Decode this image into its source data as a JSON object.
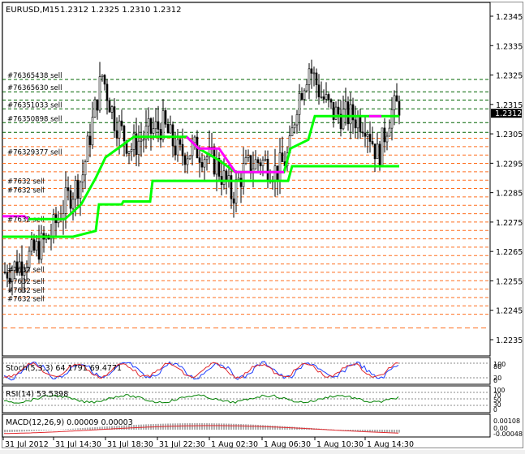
{
  "header": {
    "symbol": "EURUSD,M15",
    "ohlc": "1.2312 1.2325 1.2310 1.2312",
    "down_arrow": "▼"
  },
  "main": {
    "price_axis": [
      "1.2345",
      "1.2335",
      "1.2325",
      "1.2315",
      "1.2305",
      "1.2295",
      "1.2285",
      "1.2275",
      "1.2265",
      "1.2255",
      "1.2245",
      "1.2235"
    ],
    "current_price": "1.2312",
    "order_labels": [
      {
        "text": "#76365438 sell",
        "price": 1.23235
      },
      {
        "text": "#76365630 sell",
        "price": 1.23193
      },
      {
        "text": "#76351033 sell",
        "price": 1.23135
      },
      {
        "text": "#76350898 sell",
        "price": 1.23088
      },
      {
        "text": "#76329377 sell",
        "price": 1.22975
      },
      {
        "text": "#7632 sell",
        "price": 1.22875
      },
      {
        "text": "#7632 sell",
        "price": 1.22845
      },
      {
        "text": "#7632 sell",
        "price": 1.22745
      },
      {
        "text": "#7632 sell",
        "price": 1.22575
      },
      {
        "text": "#7632 sell",
        "price": 1.22535
      },
      {
        "text": "#7632 sell",
        "price": 1.22505
      },
      {
        "text": "#7632 sell",
        "price": 1.22475
      }
    ]
  },
  "stoch": {
    "label": "Stoch(5,3,3) 64.1791 69.4771",
    "axis": [
      "100",
      "80",
      "20",
      "0"
    ]
  },
  "rsi": {
    "label": "RSI(14) 53.5398",
    "axis": [
      "100",
      "70",
      "50",
      "30",
      "0"
    ]
  },
  "macd": {
    "label": "MACD(12,26,9) 0.00009 0.00003",
    "axis": [
      "0.00108",
      "0.00",
      "-0.00048"
    ]
  },
  "time_axis": [
    "31 Jul 2012",
    "31 Jul 14:30",
    "31 Jul 18:30",
    "31 Jul 22:30",
    "1 Aug 02:30",
    "1 Aug 06:30",
    "1 Aug 10:30",
    "1 Aug 14:30"
  ],
  "colors": {
    "bull": "#000000",
    "green_line": "#00ff00",
    "magenta_line": "#ff00ff",
    "sell_level_green": "#006400",
    "sell_level_orange": "#ff6e1e",
    "stoch_main": "#1c3cff",
    "stoch_signal": "#e0262b",
    "rsi": "#008000",
    "macd_hist": "#b0b0b0",
    "macd_signal": "#e0262b"
  }
}
